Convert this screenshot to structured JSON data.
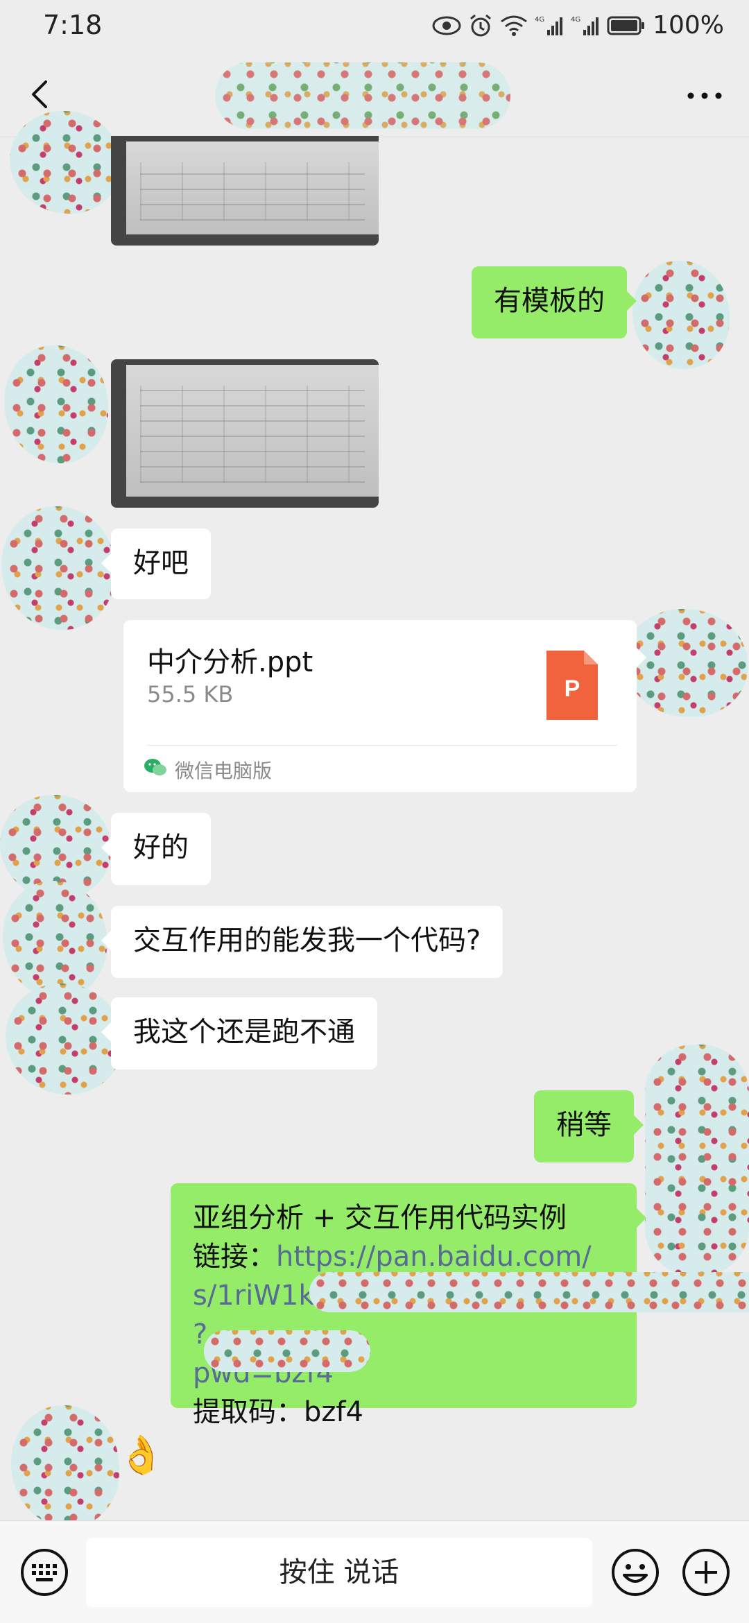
{
  "status_bar": {
    "time": "7:18",
    "battery_text": "100%",
    "icons": [
      "eye-icon",
      "alarm-icon",
      "wifi-icon",
      "signal-4g-icon",
      "signal-4g-icon",
      "battery-icon"
    ],
    "network_label": "4G"
  },
  "header": {
    "back_icon": "chevron-left-icon",
    "more_icon": "more-dots-icon"
  },
  "messages": [
    {
      "side": "in",
      "type": "image"
    },
    {
      "side": "out",
      "type": "text",
      "text": "有模板的"
    },
    {
      "side": "in",
      "type": "image"
    },
    {
      "side": "in",
      "type": "text",
      "text": "好吧"
    },
    {
      "side": "out",
      "type": "file",
      "file_name": "中介分析.ppt",
      "file_size": "55.5 KB",
      "file_icon_letter": "P",
      "source": "微信电脑版"
    },
    {
      "side": "in",
      "type": "text",
      "text": "好的"
    },
    {
      "side": "in",
      "type": "text",
      "text": "交互作用的能发我一个代码?"
    },
    {
      "side": "in",
      "type": "text",
      "text": "我这个还是跑不通"
    },
    {
      "side": "out",
      "type": "text",
      "text": "稍等"
    },
    {
      "side": "out",
      "type": "link",
      "line1": "亚组分析 + 交互作用代码实例",
      "line2_label": "链接：",
      "line2_link": "https://pan.baidu.com/",
      "line3": "s/1riW1k",
      "line3_end": "?",
      "line4": "pwd=bzf4",
      "line5": "提取码：bzf4"
    },
    {
      "side": "in",
      "type": "emoji",
      "emoji": "👌"
    }
  ],
  "input_bar": {
    "talk_label": "按住 说话",
    "keyboard_icon": "keyboard-icon",
    "emoji_icon": "smile-face-icon",
    "plus_icon": "plus-circle-icon"
  },
  "colors": {
    "background": "#ededed",
    "outgoing_bubble": "#95ec69",
    "incoming_bubble": "#ffffff",
    "link": "#576b95",
    "ppt_icon": "#f0633d"
  }
}
